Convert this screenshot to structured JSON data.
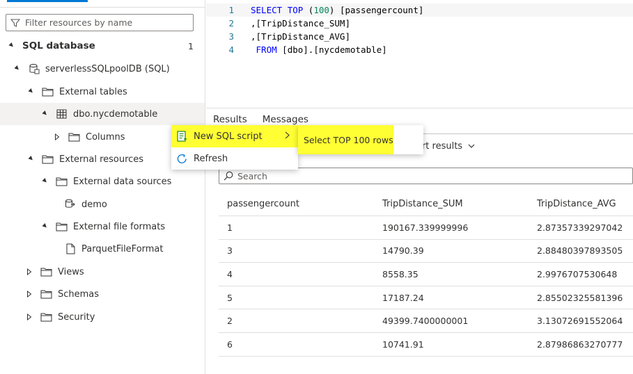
{
  "left_panel": {
    "filter_placeholder": "Filter resources by name",
    "section_title": "SQL database",
    "section_count": "1",
    "tree": [
      {
        "label": "serverlessSQLpoolDB (SQL)",
        "icon": "database-icon"
      },
      {
        "label": "External tables",
        "icon": "folder-icon"
      },
      {
        "label": "dbo.nycdemotable",
        "icon": "table-icon"
      },
      {
        "label": "Columns",
        "icon": "folder-icon"
      },
      {
        "label": "External resources",
        "icon": "folder-icon"
      },
      {
        "label": "External data sources",
        "icon": "folder-icon"
      },
      {
        "label": "demo",
        "icon": "data-source-icon"
      },
      {
        "label": "External file formats",
        "icon": "folder-icon"
      },
      {
        "label": "ParquetFileFormat",
        "icon": "file-icon"
      },
      {
        "label": "Views",
        "icon": "folder-icon"
      },
      {
        "label": "Schemas",
        "icon": "folder-icon"
      },
      {
        "label": "Security",
        "icon": "folder-icon"
      }
    ]
  },
  "editor": {
    "lines": [
      {
        "num": "1",
        "text": "SELECT TOP (100) [passengercount]"
      },
      {
        "num": "2",
        "text": ",[TripDistance_SUM]"
      },
      {
        "num": "3",
        "text": ",[TripDistance_AVG]"
      },
      {
        "num": "4",
        "text": " FROM [dbo].[nycdemotable]"
      }
    ]
  },
  "results": {
    "tabs": [
      "Results",
      "Messages"
    ],
    "export_label": "ort results",
    "search_placeholder": "Search",
    "columns": [
      "passengercount",
      "TripDistance_SUM",
      "TripDistance_AVG"
    ],
    "rows": [
      [
        "1",
        "190167.339999996",
        "2.87357339297042"
      ],
      [
        "3",
        "14790.39",
        "2.88480397893505"
      ],
      [
        "4",
        "8558.35",
        "2.9976707530648"
      ],
      [
        "5",
        "17187.24",
        "2.85502325581396"
      ],
      [
        "2",
        "49399.7400000001",
        "3.13072691552064"
      ],
      [
        "6",
        "10741.91",
        "2.87986863270777"
      ]
    ]
  },
  "context_menu": {
    "items": [
      {
        "label": "New SQL script",
        "icon": "sql-script-icon"
      },
      {
        "label": "Refresh",
        "icon": "refresh-icon"
      }
    ],
    "submenu": {
      "label": "Select TOP 100 rows"
    },
    "highlight_color": "#ffff33"
  }
}
